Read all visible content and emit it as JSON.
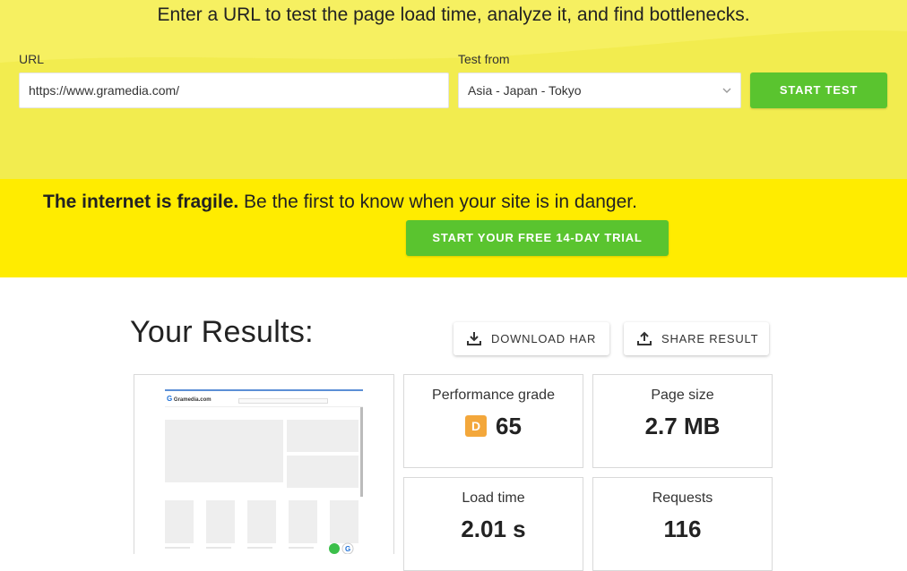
{
  "hero": {
    "title": "Enter a URL to test the page load time, analyze it, and find bottlenecks.",
    "url_label": "URL",
    "url_value": "https://www.gramedia.com/",
    "test_from_label": "Test from",
    "test_from_value": "Asia - Japan - Tokyo",
    "start_button": "START TEST"
  },
  "promo": {
    "bold": "The internet is fragile.",
    "rest": " Be the first to know when your site is in danger.",
    "trial_button": "START YOUR FREE 14-DAY TRIAL"
  },
  "results": {
    "title": "Your Results:",
    "download_button": "DOWNLOAD HAR",
    "share_button": "SHARE RESULT",
    "stats": {
      "performance": {
        "label": "Performance grade",
        "grade": "D",
        "value": "65"
      },
      "page_size": {
        "label": "Page size",
        "value": "2.7 MB"
      },
      "load_time": {
        "label": "Load time",
        "value": "2.01 s"
      },
      "requests": {
        "label": "Requests",
        "value": "116"
      }
    }
  },
  "thumbnail": {
    "logo": "Gramedia.com",
    "logo_letter": "G"
  },
  "colors": {
    "hero_bg": "#f2ec4f",
    "promo_bg": "#ffec00",
    "green": "#5ac42f",
    "grade_d": "#f3a73b"
  }
}
